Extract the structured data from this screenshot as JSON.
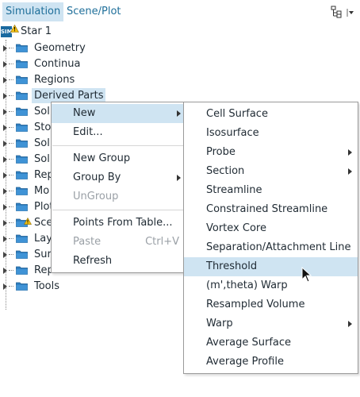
{
  "tabs": [
    {
      "label": "Simulation",
      "active": true
    },
    {
      "label": "Scene/Plot",
      "active": false
    }
  ],
  "toolbar": {
    "tree_icon": "tree-view-icon",
    "dropdown_icon": "dropdown-arrow-icon"
  },
  "tree": {
    "root": {
      "label": "Star 1",
      "icon": "sim-icon",
      "badge": "SIM",
      "warning": true
    },
    "items": [
      {
        "label": "Geometry"
      },
      {
        "label": "Continua"
      },
      {
        "label": "Regions"
      },
      {
        "label": "Derived Parts",
        "selected": true
      },
      {
        "label": "Sol"
      },
      {
        "label": "Sto"
      },
      {
        "label": "Sol"
      },
      {
        "label": "Sol"
      },
      {
        "label": "Rep"
      },
      {
        "label": "Mo"
      },
      {
        "label": "Plot"
      },
      {
        "label": "Sce",
        "warning": true
      },
      {
        "label": "Lay"
      },
      {
        "label": "Sur"
      },
      {
        "label": "Rep"
      },
      {
        "label": "Tools"
      }
    ]
  },
  "context_menu": {
    "items": [
      {
        "label": "New",
        "submenu": true,
        "highlighted": true
      },
      {
        "label": "Edit..."
      },
      {
        "label": "New Group"
      },
      {
        "label": "Group By",
        "submenu": true
      },
      {
        "label": "UnGroup",
        "disabled": true
      },
      {
        "label": "Points From Table..."
      },
      {
        "label": "Paste",
        "shortcut": "Ctrl+V",
        "disabled": true
      },
      {
        "label": "Refresh"
      }
    ]
  },
  "submenu": {
    "items": [
      {
        "label": "Cell Surface"
      },
      {
        "label": "Isosurface"
      },
      {
        "label": "Probe",
        "submenu": true
      },
      {
        "label": "Section",
        "submenu": true
      },
      {
        "label": "Streamline"
      },
      {
        "label": "Constrained Streamline"
      },
      {
        "label": "Vortex Core"
      },
      {
        "label": "Separation/Attachment Line"
      },
      {
        "label": "Threshold",
        "highlighted": true
      },
      {
        "label": "(m',theta) Warp"
      },
      {
        "label": "Resampled Volume"
      },
      {
        "label": "Warp",
        "submenu": true
      },
      {
        "label": "Average Surface"
      },
      {
        "label": "Average Profile"
      }
    ]
  },
  "colors": {
    "accent": "#1f6f9a",
    "selection": "#cfe4f2",
    "folder": "#2f7fc1",
    "warning": "#f2c012"
  }
}
